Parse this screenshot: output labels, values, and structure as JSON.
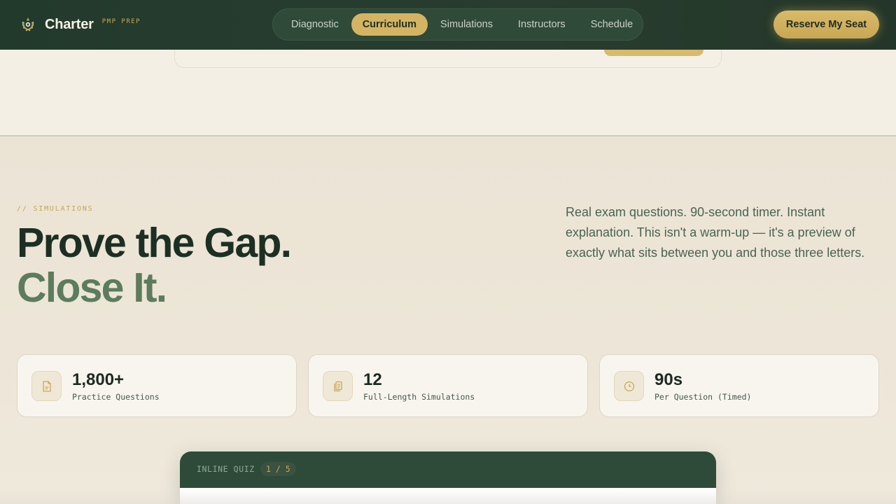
{
  "header": {
    "brand_name": "Charter",
    "brand_tag": "PMP PREP",
    "cta_label": "Reserve My Seat",
    "nav": [
      {
        "label": "Diagnostic",
        "active": false
      },
      {
        "label": "Curriculum",
        "active": true
      },
      {
        "label": "Simulations",
        "active": false
      },
      {
        "label": "Instructors",
        "active": false
      },
      {
        "label": "Schedule",
        "active": false
      }
    ]
  },
  "simulations": {
    "eyebrow": "// SIMULATIONS",
    "headline_line1": "Prove the Gap.",
    "headline_line2": "Close It.",
    "lede": "Real exam questions. 90-second timer. Instant explanation. This isn't a warm-up — it's a preview of exactly what sits between you and those three letters.",
    "stats": [
      {
        "icon": "document-icon",
        "value": "1,800+",
        "label": "Practice Questions"
      },
      {
        "icon": "clipboard-icon",
        "value": "12",
        "label": "Full-Length Simulations"
      },
      {
        "icon": "clock-icon",
        "value": "90s",
        "label": "Per Question (Timed)"
      }
    ]
  },
  "quiz": {
    "title": "INLINE QUIZ",
    "counter": "1 / 5"
  },
  "colors": {
    "header_bg": "#243a2c",
    "accent_gold": "#d4b463",
    "headline_dark": "#1d2f23",
    "headline_green": "#5c7c5d",
    "section_bg": "#ebe4d5"
  }
}
